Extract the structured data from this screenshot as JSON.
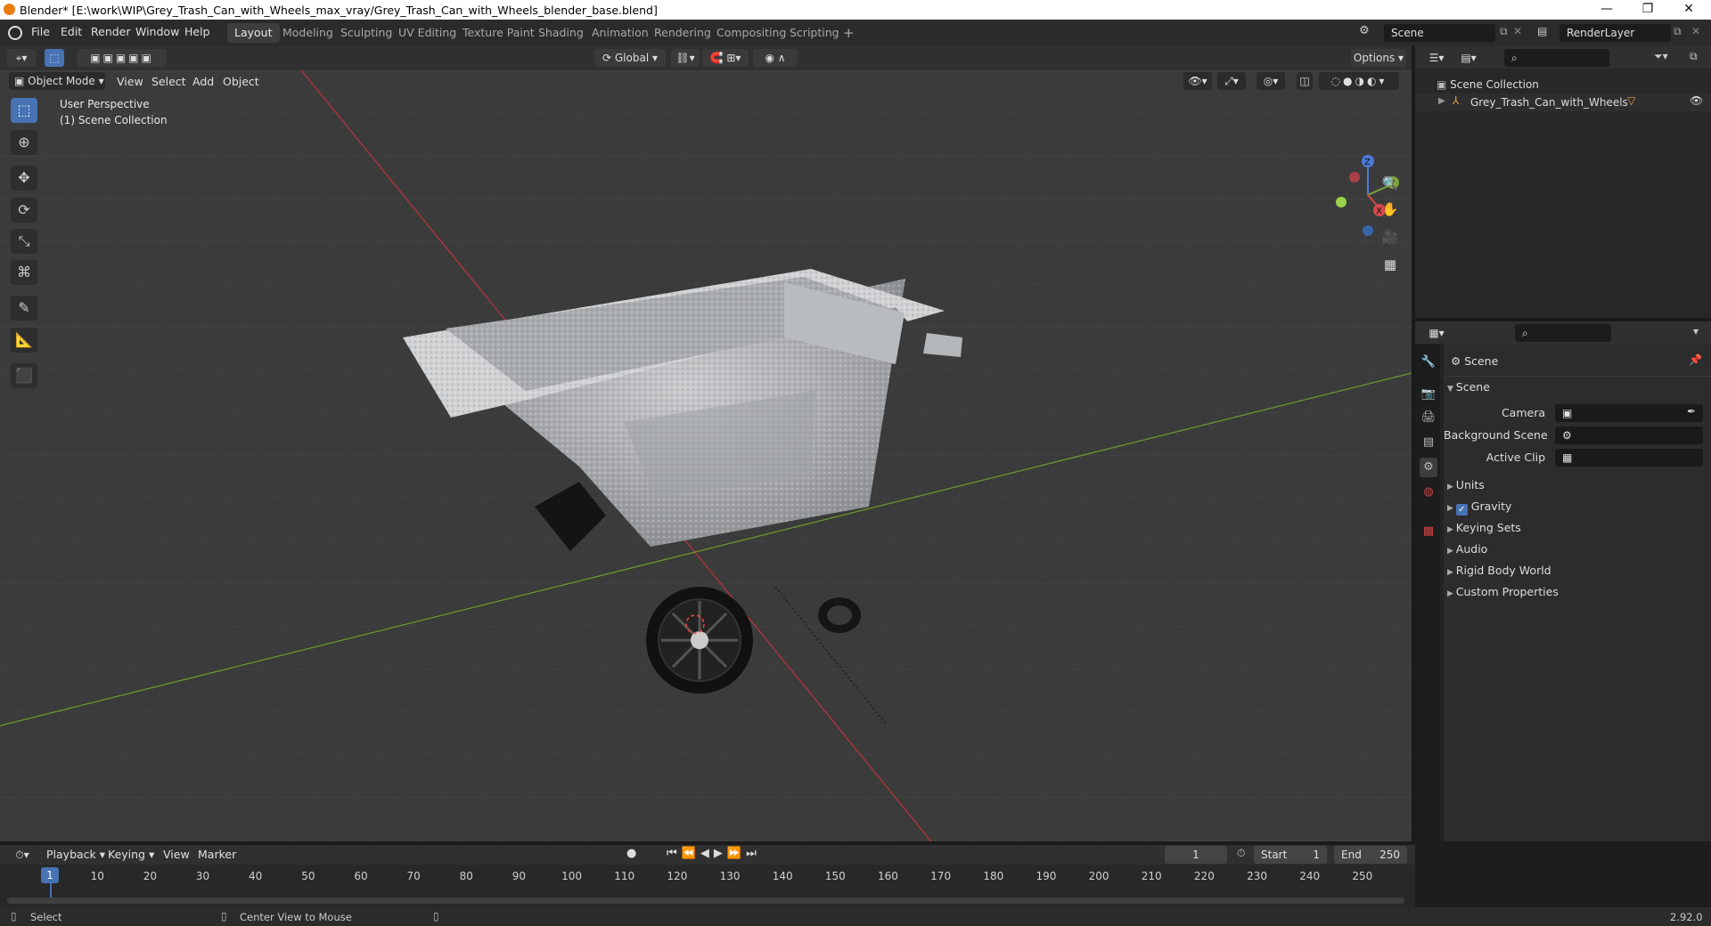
{
  "window": {
    "title": "Blender* [E:\\work\\WIP\\Grey_Trash_Can_with_Wheels_max_vray/Grey_Trash_Can_with_Wheels_blender_base.blend]",
    "minimize": "—",
    "maximize": "❐",
    "close": "✕"
  },
  "menubar": {
    "items": [
      "File",
      "Edit",
      "Render",
      "Window",
      "Help"
    ]
  },
  "workspaces": [
    "Layout",
    "Modeling",
    "Sculpting",
    "UV Editing",
    "Texture Paint",
    "Shading",
    "Animation",
    "Rendering",
    "Compositing",
    "Scripting"
  ],
  "add_workspace": "+",
  "scene_selector": "Scene",
  "viewlayer_selector": "RenderLayer",
  "viewport_header": {
    "mode": "Object Mode",
    "menus": [
      "View",
      "Select",
      "Add",
      "Object"
    ],
    "transform_orientation": "Global",
    "options": "Options"
  },
  "viewport": {
    "view_name": "User Perspective",
    "collection_label": "(1) Scene Collection",
    "gizmo_axes": {
      "x": "X",
      "y": "Y",
      "z": "Z"
    },
    "colors": {
      "x_axis": "#d34a4a",
      "y_axis": "#7ba33a",
      "bg": "#3b3b3b"
    }
  },
  "outliner": {
    "root": "Scene Collection",
    "items": [
      {
        "name": "Grey_Trash_Can_with_Wheels"
      }
    ]
  },
  "properties": {
    "context": "Scene",
    "section": "Scene",
    "fields": [
      {
        "label": "Camera",
        "value": ""
      },
      {
        "label": "Background Scene",
        "value": ""
      },
      {
        "label": "Active Clip",
        "value": ""
      }
    ],
    "panels": [
      "Units",
      "Gravity",
      "Keying Sets",
      "Audio",
      "Rigid Body World",
      "Custom Properties"
    ],
    "gravity_checked": true
  },
  "timeline": {
    "menus": [
      "Playback",
      "Keying",
      "View",
      "Marker"
    ],
    "current_frame": "1",
    "start_label": "Start",
    "start": "1",
    "end_label": "End",
    "end": "250",
    "ticks": [
      "1",
      "10",
      "20",
      "30",
      "40",
      "50",
      "60",
      "70",
      "80",
      "90",
      "100",
      "110",
      "120",
      "130",
      "140",
      "150",
      "160",
      "170",
      "180",
      "190",
      "200",
      "210",
      "220",
      "230",
      "240",
      "250"
    ]
  },
  "statusbar": {
    "left": "Select",
    "middle": "Center View to Mouse",
    "version": "2.92.0"
  }
}
